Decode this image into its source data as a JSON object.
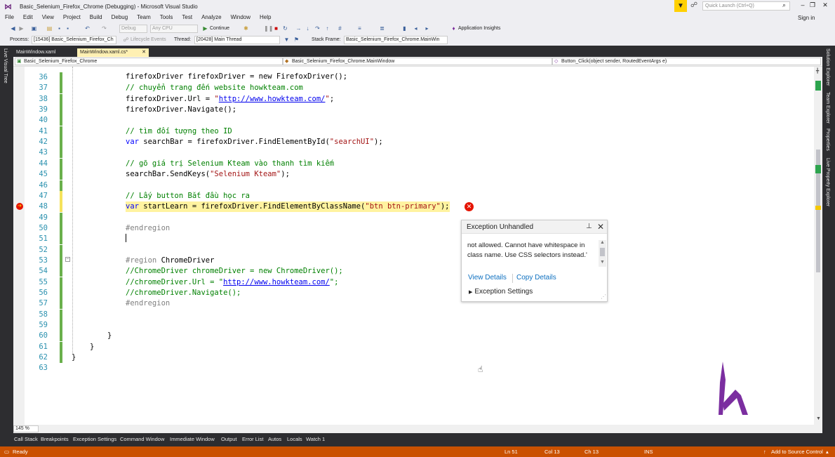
{
  "window": {
    "title": "Basic_Selenium_Firefox_Chrome (Debugging) - Microsoft Visual Studio",
    "quick_launch_placeholder": "Quick Launch (Ctrl+Q)",
    "sign_in": "Sign in"
  },
  "menu": [
    "File",
    "Edit",
    "View",
    "Project",
    "Build",
    "Debug",
    "Team",
    "Tools",
    "Test",
    "Analyze",
    "Window",
    "Help"
  ],
  "toolbar": {
    "config": "Debug",
    "platform": "Any CPU",
    "continue": "Continue",
    "app_insights": "Application Insights"
  },
  "debug_toolbar": {
    "process_label": "Process:",
    "process": "[15436] Basic_Selenium_Firefox_Ch",
    "lifecycle": "Lifecycle Events",
    "thread_label": "Thread:",
    "thread": "[20428] Main Thread",
    "stack_label": "Stack Frame:",
    "stack": "Basic_Selenium_Firefox_Chrome.MainWin"
  },
  "left_tool_tab": "Live Visual Tree",
  "right_tool_tabs": [
    "Solution Explorer",
    "Team Explorer",
    "Properties",
    "Live Property Explorer"
  ],
  "doc_tabs": [
    {
      "label": "MainWindow.xaml",
      "active": false
    },
    {
      "label": "MainWindow.xaml.cs*",
      "active": true
    }
  ],
  "nav": {
    "project": "Basic_Selenium_Firefox_Chrome",
    "class": "Basic_Selenium_Firefox_Chrome.MainWindow",
    "member": "Button_Click(object sender, RoutedEventArgs e)"
  },
  "code_lines": [
    {
      "n": "36",
      "text": ""
    },
    {
      "n": "37",
      "text": "// chuyển trang đến website howkteam.com"
    },
    {
      "n": "38",
      "text": "firefoxDriver.Url = \"http://www.howkteam.com/\";"
    },
    {
      "n": "39",
      "text": "firefoxDriver.Navigate();"
    },
    {
      "n": "40",
      "text": ""
    },
    {
      "n": "41",
      "text": "// tìm đối tượng theo ID"
    },
    {
      "n": "42",
      "text": "var searchBar = firefoxDriver.FindElementById(\"searchUI\");"
    },
    {
      "n": "43",
      "text": ""
    },
    {
      "n": "44",
      "text": "// gõ giá trị Selenium Kteam vào thanh tìm kiếm"
    },
    {
      "n": "45",
      "text": "searchBar.SendKeys(\"Selenium Kteam\");"
    },
    {
      "n": "46",
      "text": ""
    },
    {
      "n": "47",
      "text": "// Lấy button Bắt đầu học ra"
    },
    {
      "n": "48",
      "text": "var startLearn = firefoxDriver.FindElementByClassName(\"btn btn-primary\");"
    },
    {
      "n": "49",
      "text": ""
    },
    {
      "n": "50",
      "text": "#endregion"
    },
    {
      "n": "51",
      "text": ""
    },
    {
      "n": "52",
      "text": ""
    },
    {
      "n": "53",
      "text": "#region ChromeDriver"
    },
    {
      "n": "54",
      "text": "//ChromeDriver chromeDriver = new ChromeDriver();"
    },
    {
      "n": "55",
      "text": "//chromeDriver.Url = \"http://www.howkteam.com/\";"
    },
    {
      "n": "56",
      "text": "//chromeDriver.Navigate();"
    },
    {
      "n": "57",
      "text": "#endregion"
    },
    {
      "n": "58",
      "text": ""
    },
    {
      "n": "59",
      "text": ""
    },
    {
      "n": "60",
      "text": "}"
    },
    {
      "n": "61",
      "text": "}"
    },
    {
      "n": "62",
      "text": "}"
    },
    {
      "n": "63",
      "text": ""
    }
  ],
  "partial_top_line": "firefoxDriver firefoxDriver = new FirefoxDriver();",
  "exception": {
    "title": "Exception Unhandled",
    "message": "not allowed. Cannot have whitespace in class name. Use CSS selectors instead.'",
    "view_details": "View Details",
    "copy_details": "Copy Details",
    "settings": "Exception Settings"
  },
  "zoom": "145 %",
  "bottom_tabs": [
    "Call Stack",
    "Breakpoints",
    "Exception Settings",
    "Command Window",
    "Immediate Window",
    "Output",
    "Error List",
    "Autos",
    "Locals",
    "Watch 1"
  ],
  "status": {
    "ready": "Ready",
    "ln": "Ln 51",
    "col": "Col 13",
    "ch": "Ch 13",
    "ins": "INS",
    "source_control": "Add to Source Control"
  },
  "colors": {
    "status_bar": "#ca5100",
    "highlight": "#fff3a0",
    "comment": "#008000",
    "line_number": "#2b91af",
    "link": "#0e70c0"
  }
}
